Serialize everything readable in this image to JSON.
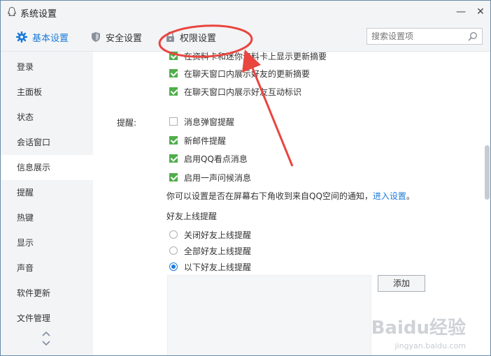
{
  "window": {
    "title": "系统设置",
    "minimize_glyph": "—",
    "close_glyph": "✕"
  },
  "toolbar": {
    "tabs": [
      {
        "label": "基本设置",
        "icon": "gear-icon"
      },
      {
        "label": "安全设置",
        "icon": "shield-icon"
      },
      {
        "label": "权限设置",
        "icon": "lock-icon"
      }
    ],
    "search_placeholder": "搜索设置项"
  },
  "sidebar": {
    "items": [
      {
        "label": "登录"
      },
      {
        "label": "主面板"
      },
      {
        "label": "状态"
      },
      {
        "label": "会话窗口"
      },
      {
        "label": "信息展示"
      },
      {
        "label": "提醒"
      },
      {
        "label": "热键"
      },
      {
        "label": "显示"
      },
      {
        "label": "声音"
      },
      {
        "label": "软件更新"
      },
      {
        "label": "文件管理"
      }
    ],
    "active_index": 4
  },
  "content": {
    "top_options": [
      {
        "label": "在资料卡和迷你资料卡上显示更新摘要",
        "checked": true
      },
      {
        "label": "在聊天窗口内展示好友的更新摘要",
        "checked": true
      },
      {
        "label": "在聊天窗口内展示好友互动标识",
        "checked": true
      }
    ],
    "remind_label": "提醒:",
    "remind_options": [
      {
        "label": "消息弹窗提醒",
        "checked": false
      },
      {
        "label": "新邮件提醒",
        "checked": true
      },
      {
        "label": "启用QQ看点消息",
        "checked": true
      },
      {
        "label": "启用一声问候消息",
        "checked": true
      }
    ],
    "note_text": "你可以设置是否在屏幕右下角收到来自QQ空间的通知，",
    "note_link": "进入设置",
    "note_end": "。",
    "friend_title": "好友上线提醒",
    "friend_options": [
      {
        "label": "关闭好友上线提醒",
        "selected": false
      },
      {
        "label": "全部好友上线提醒",
        "selected": false
      },
      {
        "label": "以下好友上线提醒",
        "selected": true
      }
    ],
    "add_button": "添加"
  },
  "colors": {
    "accent": "#1c7bd8",
    "check_green": "#4fae4a",
    "annotation_red": "#e8463f"
  },
  "watermark": {
    "text": "Baidu经验",
    "sub": "jingyan.baidu.com"
  }
}
